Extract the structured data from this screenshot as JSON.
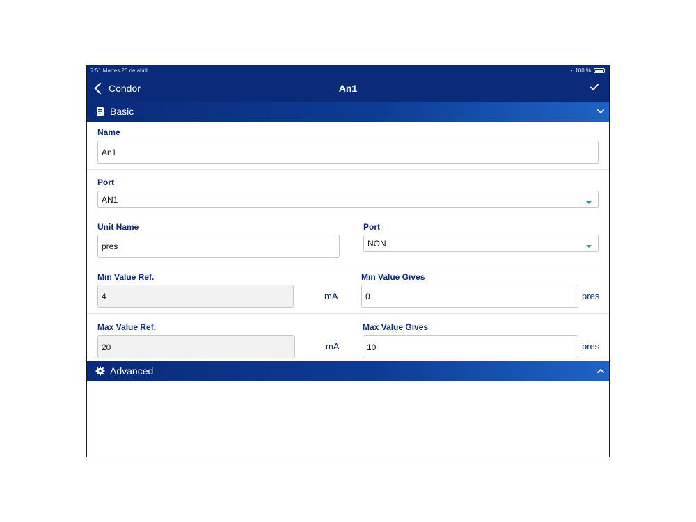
{
  "status_bar": {
    "time": "7:51  Martes 20 de abril",
    "battery": "100 %"
  },
  "nav": {
    "back_label": "Condor",
    "title": "An1"
  },
  "sections": {
    "basic": {
      "title": "Basic"
    },
    "advanced": {
      "title": "Advanced"
    }
  },
  "form": {
    "name": {
      "label": "Name",
      "value": "An1"
    },
    "port": {
      "label": "Port",
      "value": "AN1"
    },
    "unit_name": {
      "label": "Unit Name",
      "value": "pres"
    },
    "unit_port": {
      "label": "Port",
      "value": "NON"
    },
    "min_value_ref": {
      "label": "Min Value Ref.",
      "value": "4",
      "unit": "mA"
    },
    "min_value_gives": {
      "label": "Min Value Gives",
      "value": "0",
      "unit": "pres"
    },
    "max_value_ref": {
      "label": "Max Value Ref.",
      "value": "20",
      "unit": "mA"
    },
    "max_value_gives": {
      "label": "Max Value Gives",
      "value": "10",
      "unit": "pres"
    }
  },
  "colors": {
    "primary": "#0a2a7a",
    "accent": "#1e63c6",
    "dropdown_arrow": "#1e8fd6"
  },
  "icons": {
    "back": "chevron-left-icon",
    "done": "checkmark-icon",
    "basic": "document-icon",
    "advanced": "gear-icon",
    "basic_toggle": "chevron-down-icon",
    "advanced_toggle": "chevron-up-icon"
  }
}
